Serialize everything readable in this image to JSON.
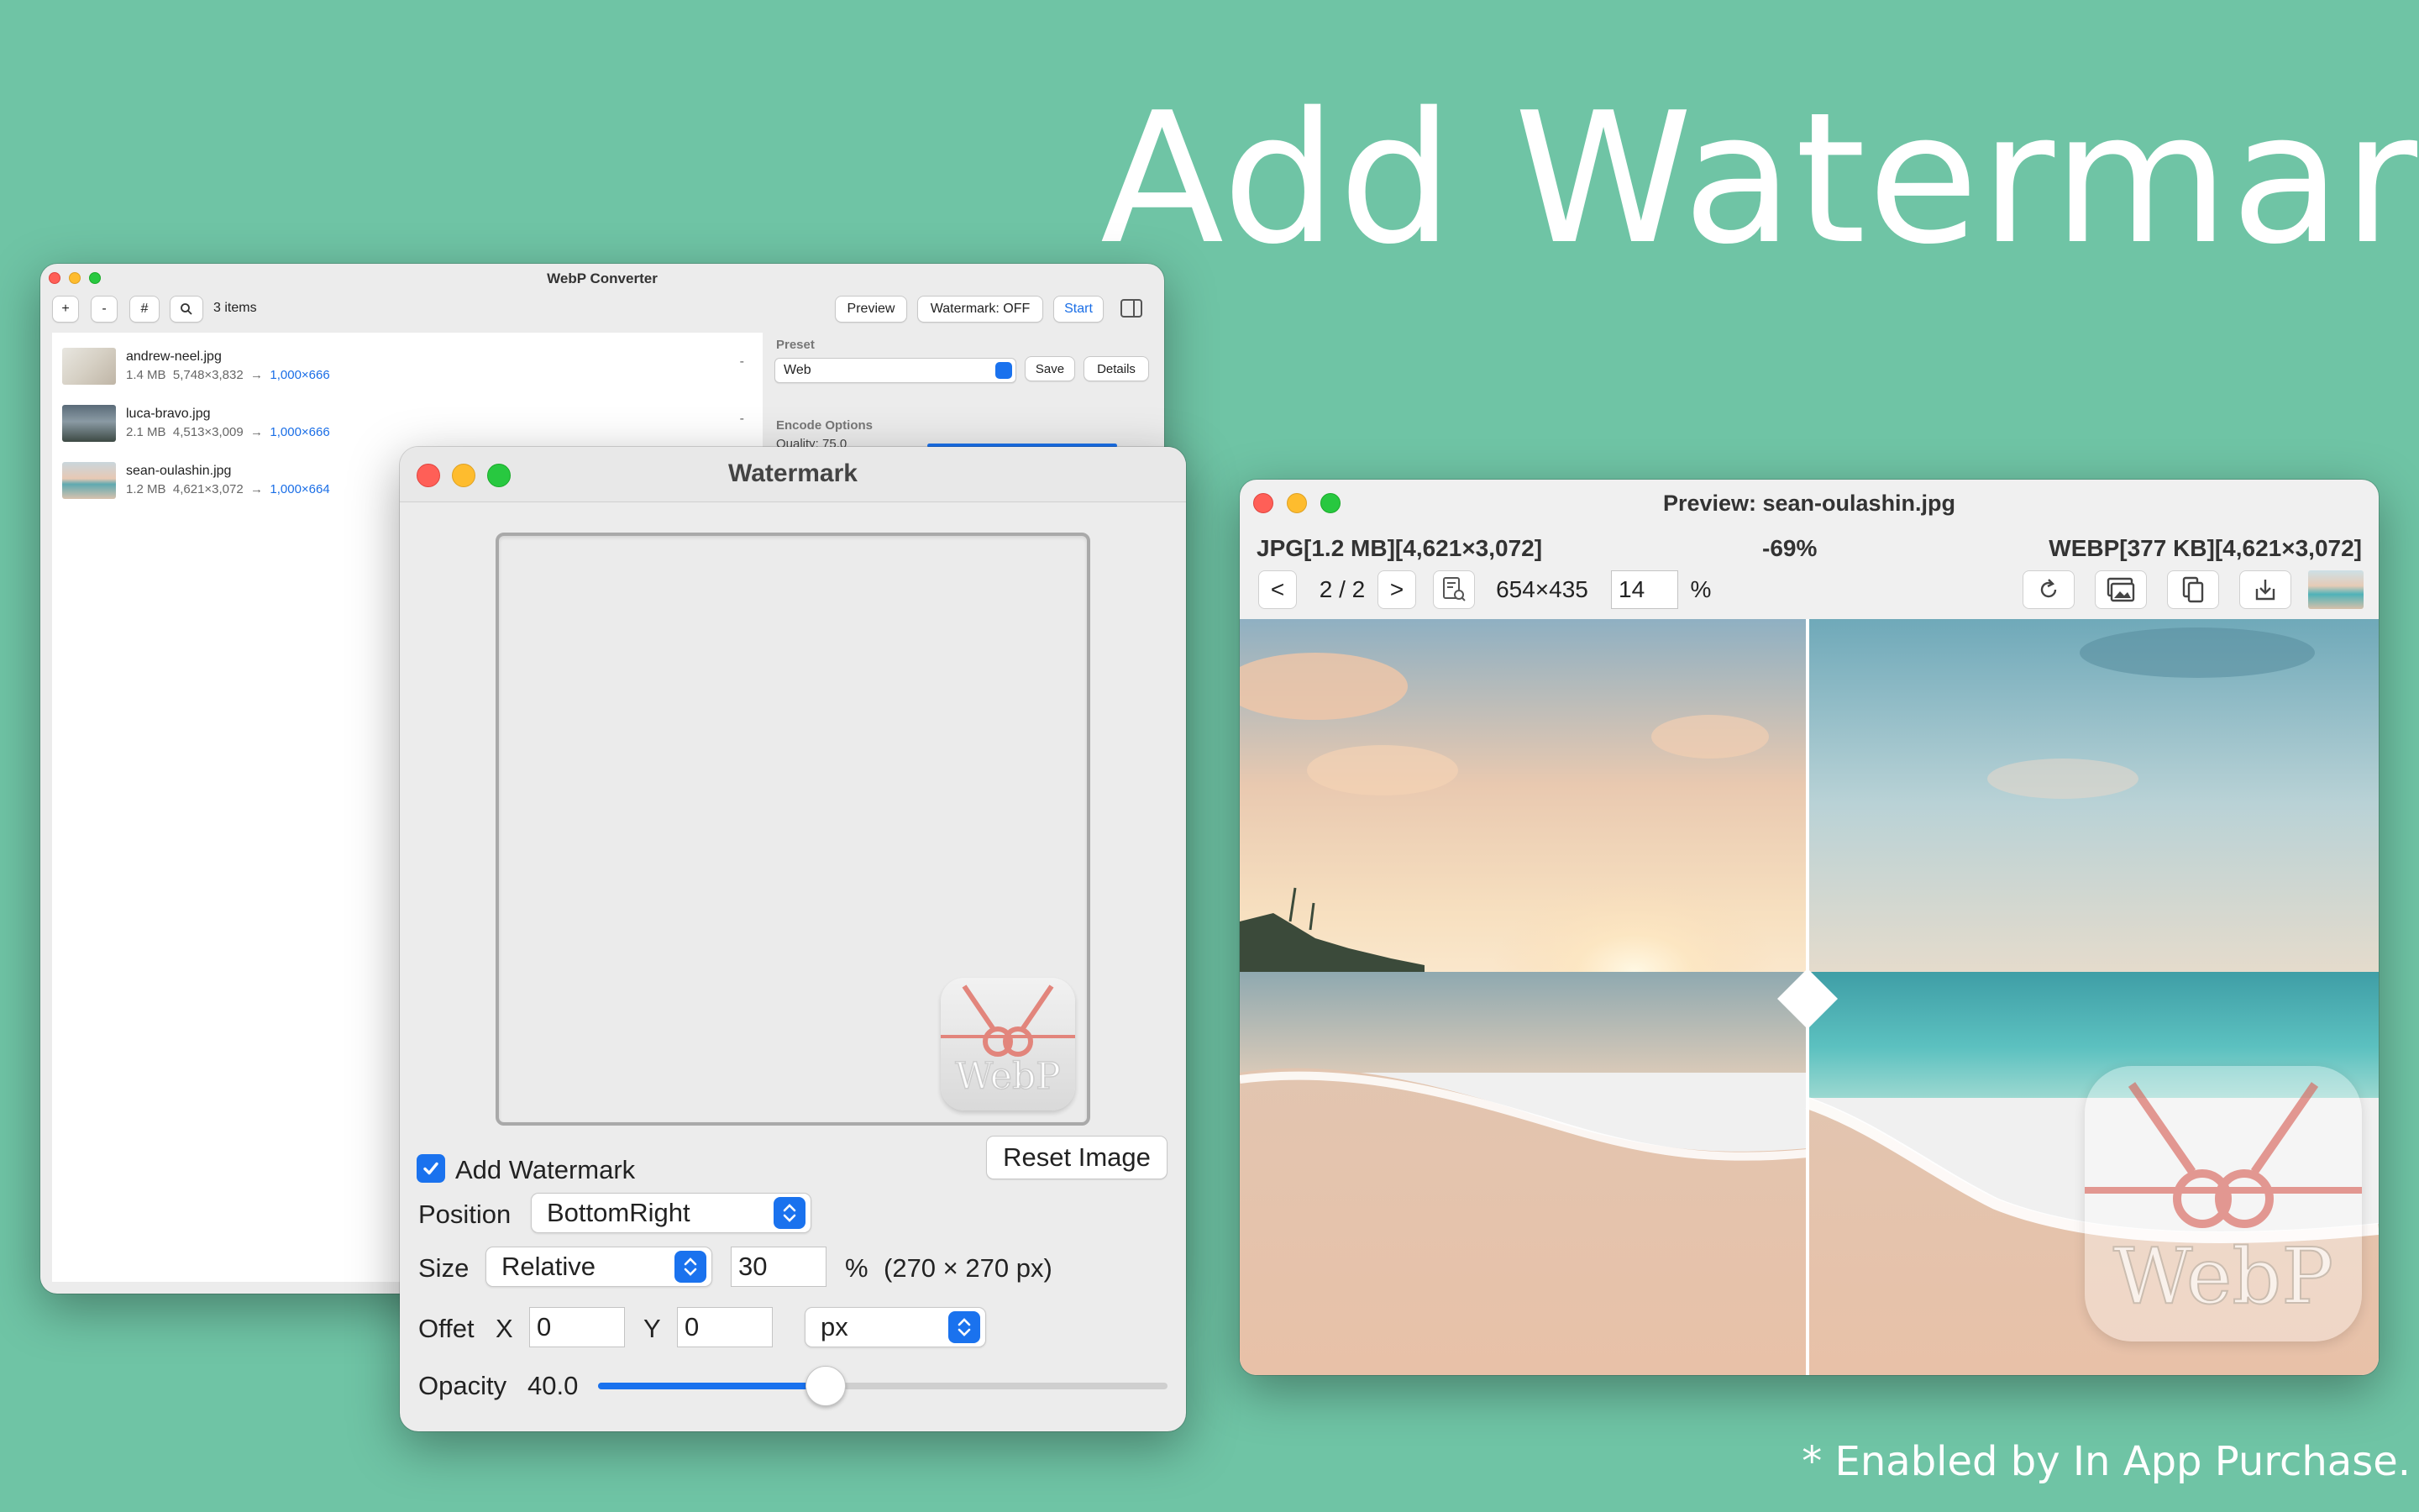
{
  "headline": "Add Watermark",
  "footnote": "* Enabled by In App Purchase.",
  "converter": {
    "title": "WebP Converter",
    "toolbar": {
      "add": "+",
      "remove": "-",
      "hash": "#",
      "items_count": "3 items",
      "preview": "Preview",
      "watermark": "Watermark: OFF",
      "start": "Start"
    },
    "files": [
      {
        "name": "andrew-neel.jpg",
        "size": "1.4 MB",
        "dims": "5,748×3,832",
        "out": "1,000×666",
        "status": "-"
      },
      {
        "name": "luca-bravo.jpg",
        "size": "2.1 MB",
        "dims": "4,513×3,009",
        "out": "1,000×666",
        "status": "-"
      },
      {
        "name": "sean-oulashin.jpg",
        "size": "1.2 MB",
        "dims": "4,621×3,072",
        "out": "1,000×664",
        "status": ""
      }
    ],
    "preset_label": "Preset",
    "preset_value": "Web",
    "save": "Save",
    "details": "Details",
    "encode_options": "Encode Options",
    "quality": "Quality: 75.0"
  },
  "watermark_window": {
    "title": "Watermark",
    "add_watermark": "Add Watermark",
    "add_watermark_checked": true,
    "reset_image": "Reset Image",
    "position_label": "Position",
    "position_value": "BottomRight",
    "size_label": "Size",
    "size_mode": "Relative",
    "size_value": "30",
    "size_unit": "%",
    "size_px": "(270 × 270 px)",
    "offset_label": "Offet",
    "x_label": "X",
    "x_value": "0",
    "y_label": "Y",
    "y_value": "0",
    "offset_unit": "px",
    "opacity_label": "Opacity",
    "opacity_value": "40.0",
    "opacity_fraction": 0.4,
    "logo_text": "WebP"
  },
  "preview": {
    "title": "Preview: sean-oulashin.jpg",
    "left_info": "JPG[1.2 MB][4,621×3,072]",
    "ratio": "-69%",
    "right_info": "WEBP[377 KB][4,621×3,072]",
    "prev": "<",
    "page": "2 / 2",
    "next": ">",
    "view_size": "654×435",
    "zoom": "14",
    "zoom_unit": "%",
    "logo_text": "WebP"
  },
  "colors": {
    "background": "#6fc4a5",
    "accent": "#1a72ee",
    "link": "#1a6ee6"
  }
}
